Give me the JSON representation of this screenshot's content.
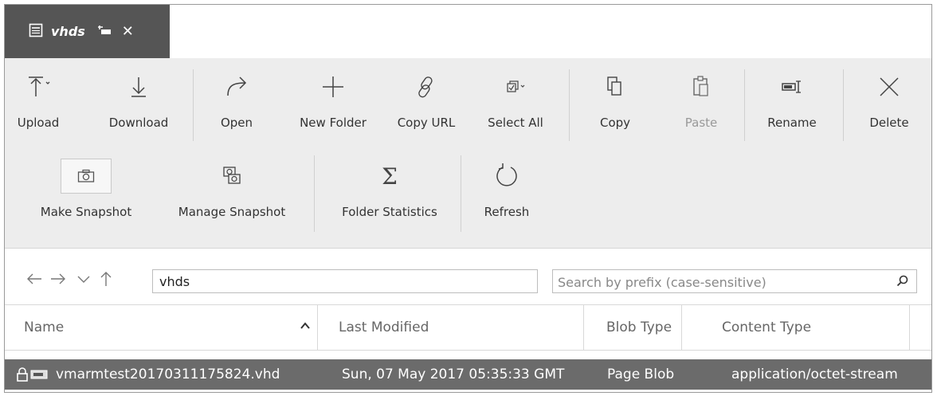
{
  "tab": {
    "title": "vhds"
  },
  "ribbon": {
    "upload": "Upload",
    "download": "Download",
    "open": "Open",
    "new_folder": "New Folder",
    "copy_url": "Copy URL",
    "select_all": "Select All",
    "copy": "Copy",
    "paste": "Paste",
    "rename": "Rename",
    "delete": "Delete",
    "make_snapshot": "Make Snapshot",
    "manage_snapshot": "Manage Snapshot",
    "folder_statistics": "Folder Statistics",
    "refresh": "Refresh",
    "sigma": "Σ"
  },
  "address": {
    "path": "vhds",
    "search_placeholder": "Search by prefix (case-sensitive)"
  },
  "columns": [
    "Name",
    "Last Modified",
    "Blob Type",
    "Content Type"
  ],
  "rows": [
    {
      "name": "vmarmtest20170311175824.vhd",
      "last_modified": "Sun, 07 May 2017 05:35:33 GMT",
      "blob_type": "Page Blob",
      "content_type": "application/octet-stream"
    }
  ],
  "colors": {
    "tab_bg": "#555555",
    "ribbon_bg": "#ededed",
    "selected_row": "#6b6b6b"
  }
}
